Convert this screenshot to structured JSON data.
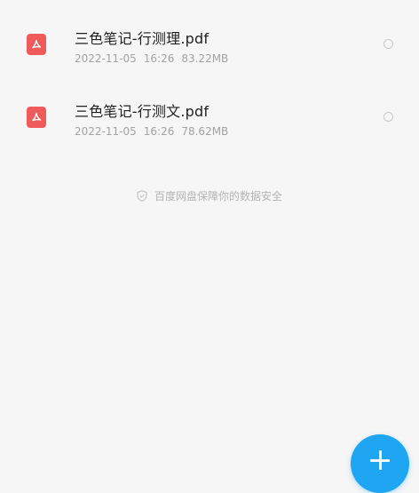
{
  "files": [
    {
      "name": "三色笔记-行测理.pdf",
      "date": "2022-11-05",
      "time": "16:26",
      "size": "83.22MB",
      "icon": "pdf-file-icon"
    },
    {
      "name": "三色笔记-行测文.pdf",
      "date": "2022-11-05",
      "time": "16:26",
      "size": "78.62MB",
      "icon": "pdf-file-icon"
    }
  ],
  "security_note": {
    "icon": "shield-icon",
    "text": "百度网盘保障你的数据安全"
  },
  "fab": {
    "icon": "plus-icon"
  },
  "colors": {
    "background": "#f6f6f6",
    "pdf_icon": "#ef5a5a",
    "fab": "#1fa6f2",
    "meta_text": "#a3a3a3"
  }
}
